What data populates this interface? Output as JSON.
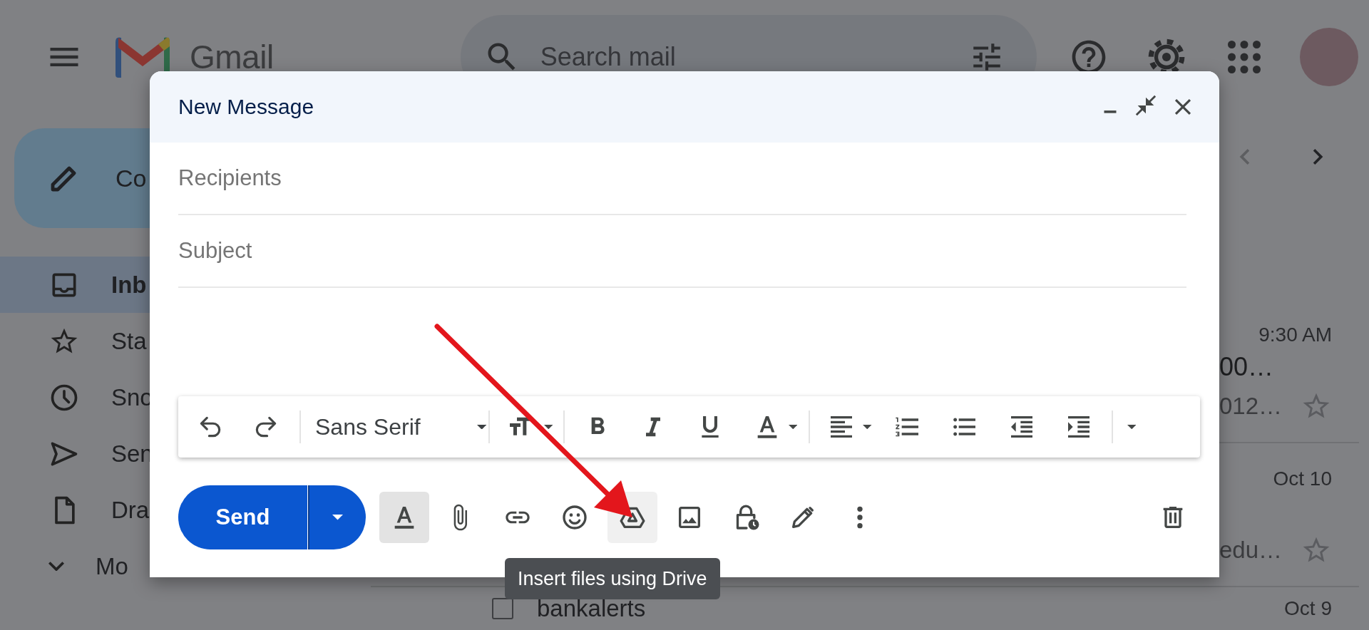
{
  "header": {
    "logo_text": "Gmail",
    "search": {
      "placeholder": "Search mail"
    }
  },
  "sidebar": {
    "compose_label": "Co",
    "items": [
      {
        "label": "Inb",
        "selected": true
      },
      {
        "label": "Sta",
        "selected": false
      },
      {
        "label": "Sno",
        "selected": false
      },
      {
        "label": "Sen",
        "selected": false
      },
      {
        "label": "Dra",
        "selected": false
      },
      {
        "label": "Mo",
        "selected": false
      }
    ]
  },
  "mail_list": {
    "rows": [
      {
        "kind": "snippet",
        "time": "9:30 AM",
        "lines": [
          "00…",
          "012…"
        ],
        "starred": false
      },
      {
        "kind": "snippet",
        "time": "Oct 10",
        "lines": [
          "edu…"
        ],
        "starred": false
      },
      {
        "kind": "sender",
        "time": "Oct 9",
        "sender": "bankalerts",
        "checked": false
      }
    ]
  },
  "compose": {
    "title": "New Message",
    "recipients": {
      "placeholder": "Recipients"
    },
    "subject": {
      "placeholder": "Subject"
    },
    "font": "Sans Serif",
    "send_label": "Send",
    "format_options": {
      "on": true
    },
    "drive_button": {
      "highlighted": true
    },
    "tooltip": "Insert files using Drive"
  }
}
